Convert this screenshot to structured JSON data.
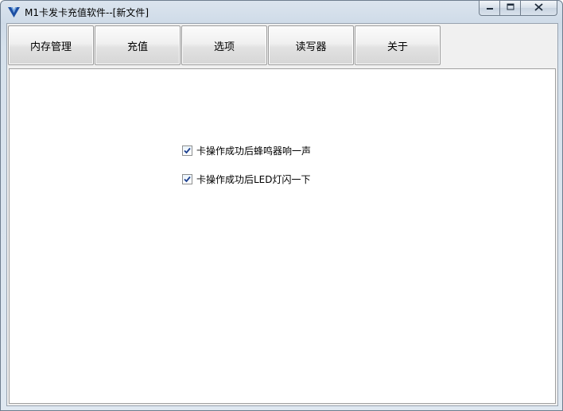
{
  "window": {
    "title": "M1卡发卡充值软件--[新文件]"
  },
  "icons": {
    "app": "app-logo-icon",
    "minimize": "minimize-icon",
    "maximize": "maximize-icon",
    "close": "close-icon",
    "checkbox": "checkmark-icon"
  },
  "toolbar": {
    "buttons": [
      {
        "label": "内存管理"
      },
      {
        "label": "充值"
      },
      {
        "label": "选项"
      },
      {
        "label": "读写器"
      },
      {
        "label": "关于"
      }
    ]
  },
  "options": {
    "items": [
      {
        "label": "卡操作成功后蜂鸣器响一声",
        "checked": true
      },
      {
        "label": "卡操作成功后LED灯闪一下",
        "checked": true
      }
    ]
  },
  "colors": {
    "frame": "#cfdbe8",
    "client_bg": "#f0f0f0",
    "panel_bg": "#ffffff",
    "check_mark": "#1c3f8f"
  }
}
